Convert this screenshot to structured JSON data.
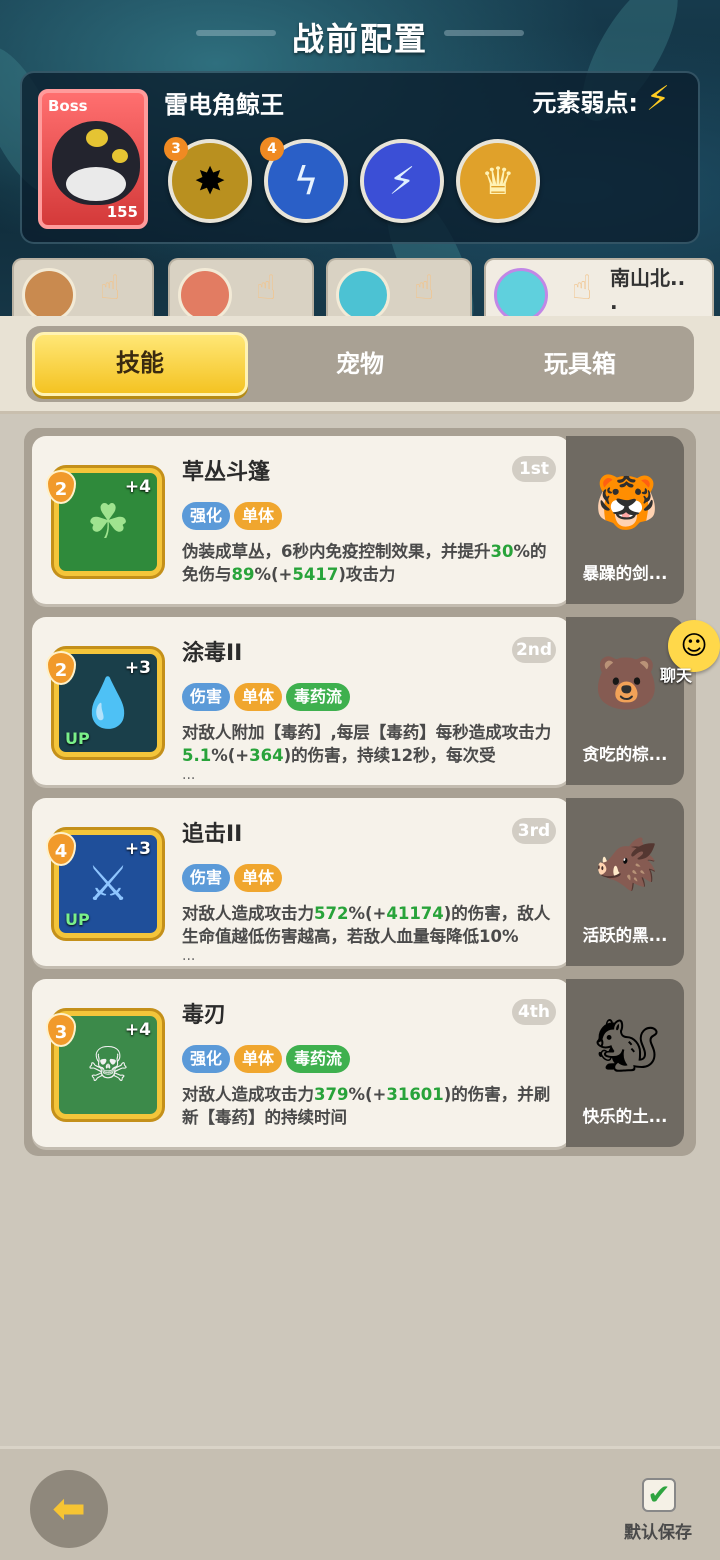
{
  "header": {
    "title": "战前配置"
  },
  "boss": {
    "tag": "Boss",
    "name": "雷电角鲸王",
    "level": "155",
    "weakness_label": "元素弱点:",
    "weakness_icon": "lightning-icon",
    "skills": [
      {
        "level": "3",
        "icon": "golden-spike-icon",
        "color": "#b9901f"
      },
      {
        "level": "4",
        "icon": "blue-lightning-icon",
        "color": "#2a5fc7"
      },
      {
        "level": "",
        "icon": "lightning-bolt-icon",
        "color": "#3b4fd6"
      },
      {
        "level": "",
        "icon": "golden-crown-icon",
        "color": "#e0a12a"
      }
    ]
  },
  "teammates": [
    {
      "name": "",
      "avatar": "boy-hunter-avatar"
    },
    {
      "name": "",
      "avatar": "red-hair-avatar"
    },
    {
      "name": "",
      "avatar": "cyan-spirit-avatar"
    },
    {
      "name": "南山北..\n.",
      "avatar": "cyan-spirit-avatar-2"
    }
  ],
  "tabs": [
    {
      "label": "技能",
      "active": true
    },
    {
      "label": "宠物",
      "active": false
    },
    {
      "label": "玩具箱",
      "active": false
    }
  ],
  "skills": [
    {
      "name": "草丛斗篷",
      "rank": "1st",
      "level": "2",
      "plus": "+4",
      "up": "",
      "icon": "bush-cloak-icon",
      "icon_bg": "#2f8a3b",
      "tags": [
        {
          "label": "强化",
          "color": "blue"
        },
        {
          "label": "单体",
          "color": "orange"
        }
      ],
      "desc_parts": [
        "伪装成草丛，6秒内免疫控制效果，并提升",
        "30",
        "%的免伤与",
        "89",
        "%(+",
        "5417",
        ")攻击力"
      ],
      "ellipsis": ""
    },
    {
      "name": "涂毒II",
      "rank": "2nd",
      "level": "2",
      "plus": "+3",
      "up": "UP",
      "icon": "poison-drop-icon",
      "icon_bg": "#1a3f4a",
      "tags": [
        {
          "label": "伤害",
          "color": "blue"
        },
        {
          "label": "单体",
          "color": "orange"
        },
        {
          "label": "毒药流",
          "color": "green"
        }
      ],
      "desc_parts": [
        "对敌人附加【毒药】,每层【毒药】每秒造成攻击力",
        "5.1",
        "%(+",
        "364",
        ")的伤害，持续12秒，每次受"
      ],
      "ellipsis": "..."
    },
    {
      "name": "追击II",
      "rank": "3rd",
      "level": "4",
      "plus": "+3",
      "up": "UP",
      "icon": "pursuit-strike-icon",
      "icon_bg": "#1f4f9a",
      "tags": [
        {
          "label": "伤害",
          "color": "blue"
        },
        {
          "label": "单体",
          "color": "orange"
        }
      ],
      "desc_parts": [
        "对敌人造成攻击力",
        "572",
        "%(+",
        "41174",
        ")的伤害，敌人生命值越低伤害越高，若敌人血量每降低10%"
      ],
      "ellipsis": "..."
    },
    {
      "name": "毒刃",
      "rank": "4th",
      "level": "3",
      "plus": "+4",
      "up": "",
      "icon": "poison-skull-icon",
      "icon_bg": "#3c8a4a",
      "tags": [
        {
          "label": "强化",
          "color": "blue"
        },
        {
          "label": "单体",
          "color": "orange"
        },
        {
          "label": "毒药流",
          "color": "green"
        }
      ],
      "desc_parts": [
        "对敌人造成攻击力",
        "379",
        "%(+",
        "31601",
        ")的伤害，并刷新【毒药】的持续时间"
      ],
      "ellipsis": ""
    }
  ],
  "pets": [
    {
      "name": "暴躁的剑...",
      "icon": "tiger-pet-icon"
    },
    {
      "name": "贪吃的棕...",
      "icon": "bear-pet-icon"
    },
    {
      "name": "活跃的黑...",
      "icon": "boar-pet-icon"
    },
    {
      "name": "快乐的土...",
      "icon": "squirrel-pet-icon"
    }
  ],
  "chat": {
    "label": "聊天"
  },
  "bottom": {
    "back_icon": "back-arrow-icon",
    "save_label": "默认保存",
    "save_checked": true
  }
}
